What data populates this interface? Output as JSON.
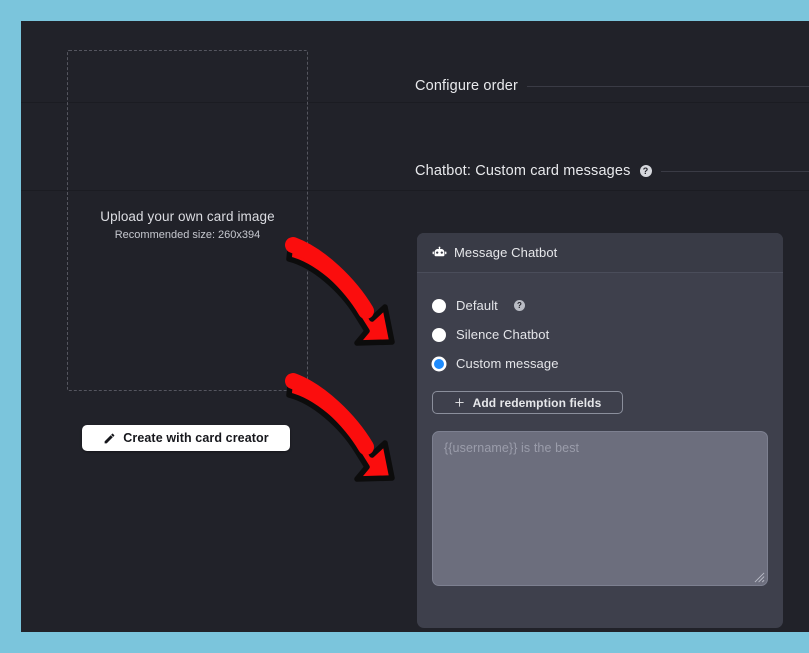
{
  "theme": {
    "page_border_color": "#7BC5DC",
    "app_background": "#212229",
    "panel_background": "#3E404C",
    "panel_header_background": "#393B46",
    "textarea_background": "#6C6E7D",
    "accent_selected_radio": "#1E8BFD",
    "annotation_arrow_color": "#FB0D0D",
    "annotation_arrow_outline": "#0C0C0C",
    "button_primary_background": "#FFFFFF",
    "section_rule_color": "#3A3B45"
  },
  "left_panel": {
    "dropzone": {
      "title": "Upload your own card image",
      "subtitle": "Recommended size: 260x394",
      "border_style": "dashed"
    },
    "create_button": {
      "label": "Create with card creator",
      "icon": "pencil-icon"
    }
  },
  "sections": [
    {
      "id": "configure-order",
      "title": "Configure order",
      "has_help_icon": false
    },
    {
      "id": "chatbot-custom-card-messages",
      "title": "Chatbot: Custom card messages",
      "has_help_icon": true,
      "help_glyph": "?"
    }
  ],
  "chatbot_panel": {
    "header": {
      "title": "Message Chatbot",
      "icon": "bot-icon"
    },
    "options": [
      {
        "label": "Default",
        "selected": false,
        "has_help_icon": true,
        "help_glyph": "?"
      },
      {
        "label": "Silence Chatbot",
        "selected": false,
        "has_help_icon": false
      },
      {
        "label": "Custom message",
        "selected": true,
        "has_help_icon": false
      }
    ],
    "add_fields_button": {
      "label": "Add redemption fields",
      "icon": "plus-icon"
    },
    "message_textarea": {
      "value": "",
      "placeholder": "{{username}} is the best",
      "resizable": true
    }
  },
  "annotations": {
    "arrows": [
      {
        "name": "arrow-to-custom-message-radio",
        "points_at": "Custom message"
      },
      {
        "name": "arrow-to-message-textarea",
        "points_at": "message textarea"
      }
    ]
  }
}
